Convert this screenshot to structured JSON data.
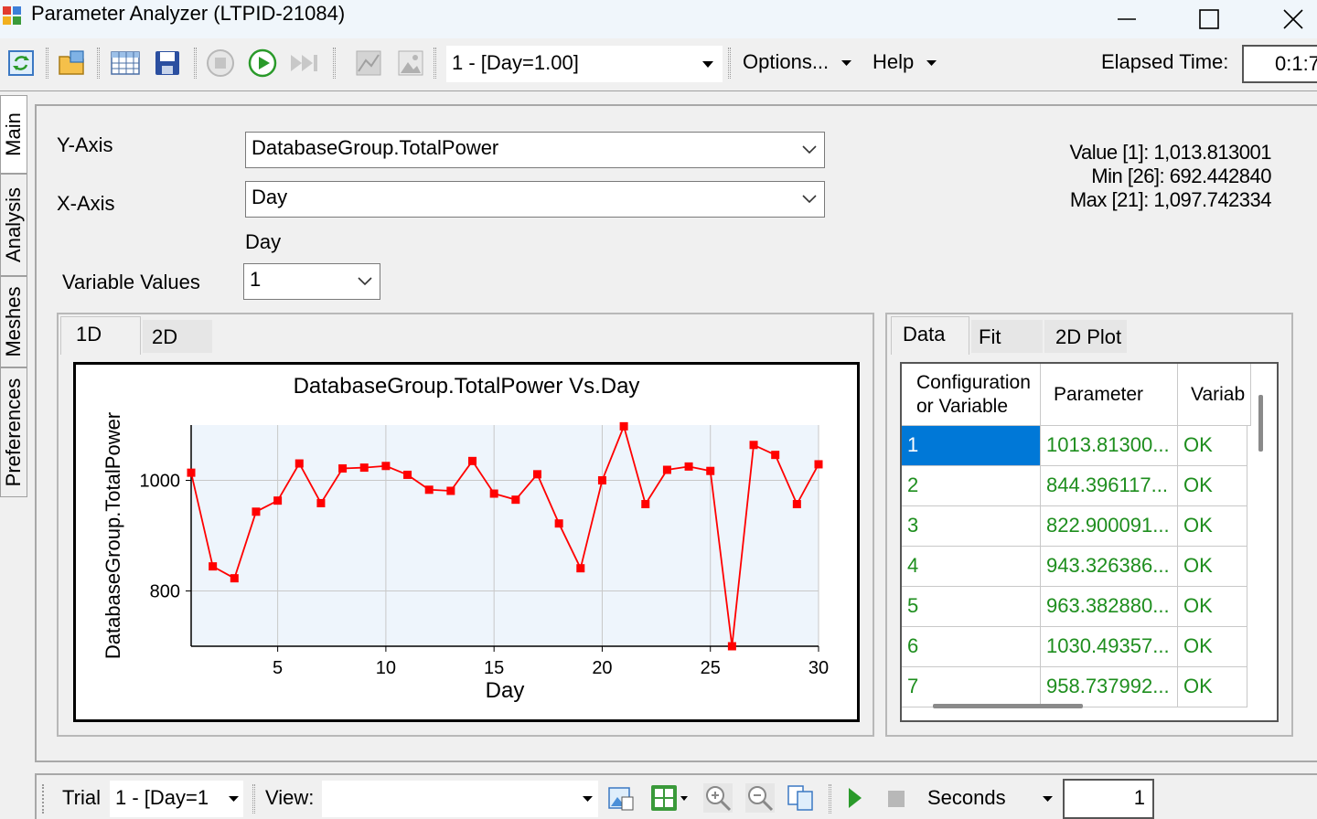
{
  "window": {
    "title": "Parameter Analyzer (LTPID-21084)"
  },
  "toolbar": {
    "icons": [
      "refresh-icon",
      "open-folder-icon",
      "table-icon",
      "save-icon",
      "stop-icon",
      "play-icon",
      "fast-forward-icon",
      "chart-disabled-icon",
      "image-icon"
    ],
    "trial_select": "1 - [Day=1.00]",
    "options_label": "Options...",
    "help_label": "Help",
    "elapsed_label": "Elapsed Time:",
    "elapsed_value": "0:1:7"
  },
  "side_tabs": [
    "Main",
    "Analysis",
    "Meshes",
    "Preferences"
  ],
  "form": {
    "y_axis_label": "Y-Axis",
    "y_axis_value": "DatabaseGroup.TotalPower",
    "x_axis_label": "X-Axis",
    "x_axis_value": "Day",
    "x_axis_caption": "Day",
    "variable_values_label": "Variable Values",
    "variable_values_value": "1"
  },
  "stats": {
    "value": "Value [1]: 1,013.813001",
    "min": "Min [26]: 692.442840",
    "max": "Max [21]: 1,097.742334"
  },
  "plot_tabs": [
    "1D",
    "2D"
  ],
  "data_tabs": [
    "Data",
    "Fit",
    "2D Plot"
  ],
  "chart_data": {
    "type": "line",
    "title": "DatabaseGroup.TotalPower Vs.Day",
    "xlabel": "Day",
    "ylabel": "DatabaseGroup.TotalPower",
    "x": [
      1,
      2,
      3,
      4,
      5,
      6,
      7,
      8,
      9,
      10,
      11,
      12,
      13,
      14,
      15,
      16,
      17,
      18,
      19,
      20,
      21,
      22,
      23,
      24,
      25,
      26,
      27,
      28,
      29,
      30
    ],
    "series": [
      {
        "values": [
          1013.813,
          844.396,
          822.9,
          943.326,
          963.383,
          1030.494,
          958.738,
          1021.5,
          1023.0,
          1026.0,
          1010.0,
          983.0,
          981.0,
          1035.0,
          976.0,
          965.0,
          1011.0,
          922.0,
          841.0,
          1000.0,
          1097.742,
          957.0,
          1019.0,
          1025.0,
          1017.0,
          692.443,
          1064.0,
          1046.0,
          957.0,
          1029.0
        ]
      }
    ],
    "xlim": [
      1,
      30
    ],
    "ylim": [
      700,
      1100
    ],
    "xticks": [
      "5",
      "10",
      "15",
      "20",
      "25",
      "30"
    ],
    "yticks": [
      "800",
      "1000"
    ],
    "grid": true,
    "line_color": "#ff0000",
    "plot_bg": "#eef5fc"
  },
  "table": {
    "headers": [
      "Configuration or Variable",
      "Parameter",
      "Variab"
    ],
    "rows": [
      {
        "config": "1",
        "parameter": "1013.81300...",
        "status": "OK"
      },
      {
        "config": "2",
        "parameter": "844.396117...",
        "status": "OK"
      },
      {
        "config": "3",
        "parameter": "822.900091...",
        "status": "OK"
      },
      {
        "config": "4",
        "parameter": "943.326386...",
        "status": "OK"
      },
      {
        "config": "5",
        "parameter": "963.382880...",
        "status": "OK"
      },
      {
        "config": "6",
        "parameter": "1030.49357...",
        "status": "OK"
      },
      {
        "config": "7",
        "parameter": "958.737992...",
        "status": "OK"
      }
    ],
    "selected_color": "#0078d7"
  },
  "statusbar": {
    "trial_label": "Trial",
    "trial_value": "1 - [Day=1",
    "view_label": "View:",
    "units_value": "Seconds",
    "step_value": "1"
  }
}
